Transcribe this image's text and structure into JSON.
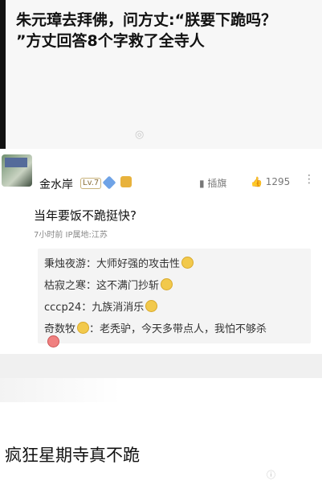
{
  "header": {
    "title_line1": "朱元璋去拜佛，问方丈:“朕要下跪吗？",
    "title_line2": "”方丈回答8个字救了全寺人",
    "watermark": "◎"
  },
  "post": {
    "username": "金水岸",
    "level": "Lv.7",
    "report_label": "▮ 插旗",
    "likes": "1295",
    "more": "⋮",
    "comment": "当年要饭不跪挺快?",
    "meta": "7小时前  IP属地:江苏"
  },
  "replies": [
    {
      "who": "秉烛夜游",
      "text": "：大师好强的攻击性"
    },
    {
      "who": "枯寂之寒",
      "text": "：这不满门抄斩"
    },
    {
      "who": "cccp24",
      "text": "：九族消消乐"
    },
    {
      "who": "奇数牧",
      "text": "：老秃驴，今天多带点人，我怕不够杀"
    }
  ],
  "caption": "疯狂星期寺真不跪",
  "bottom_watermark": "ⓘ"
}
